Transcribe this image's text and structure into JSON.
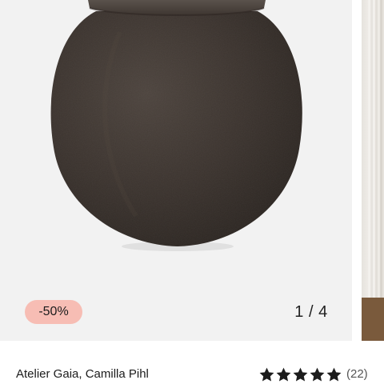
{
  "product": {
    "brand": "Atelier Gaia, Camilla Pihl",
    "discount_label": "-50%",
    "rating_value": 5,
    "rating_max": 5,
    "review_count": "(22)"
  },
  "gallery": {
    "counter": "1 / 4",
    "current": 1,
    "total": 4
  },
  "icons": {
    "star": "star-icon"
  },
  "colors": {
    "badge_bg": "#f7bdb4",
    "pot": "#3f3732",
    "star": "#1c1c1c"
  }
}
